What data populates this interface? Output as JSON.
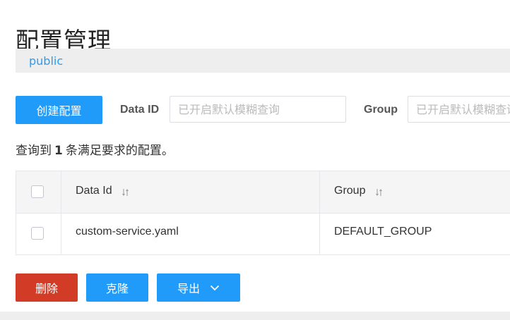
{
  "page": {
    "title": "配置管理"
  },
  "namespace": {
    "active": "public"
  },
  "toolbar": {
    "create_label": "创建配置",
    "data_id_label": "Data ID",
    "data_id_placeholder": "已开启默认模糊查询",
    "group_label": "Group",
    "group_placeholder": "已开启默认模糊查询"
  },
  "summary": {
    "prefix": "查询到",
    "count": "1",
    "suffix": "条满足要求的配置。"
  },
  "table": {
    "columns": [
      {
        "label": "Data Id"
      },
      {
        "label": "Group"
      }
    ],
    "rows": [
      {
        "data_id": "custom-service.yaml",
        "group": "DEFAULT_GROUP"
      }
    ]
  },
  "actions": {
    "delete_label": "删除",
    "clone_label": "克隆",
    "export_label": "导出"
  },
  "colors": {
    "primary": "#209bfa",
    "danger": "#d23c26",
    "link": "#2a9cf1"
  },
  "icons": {
    "sort": "sort-icon",
    "dropdown": "chevron-down-icon"
  }
}
